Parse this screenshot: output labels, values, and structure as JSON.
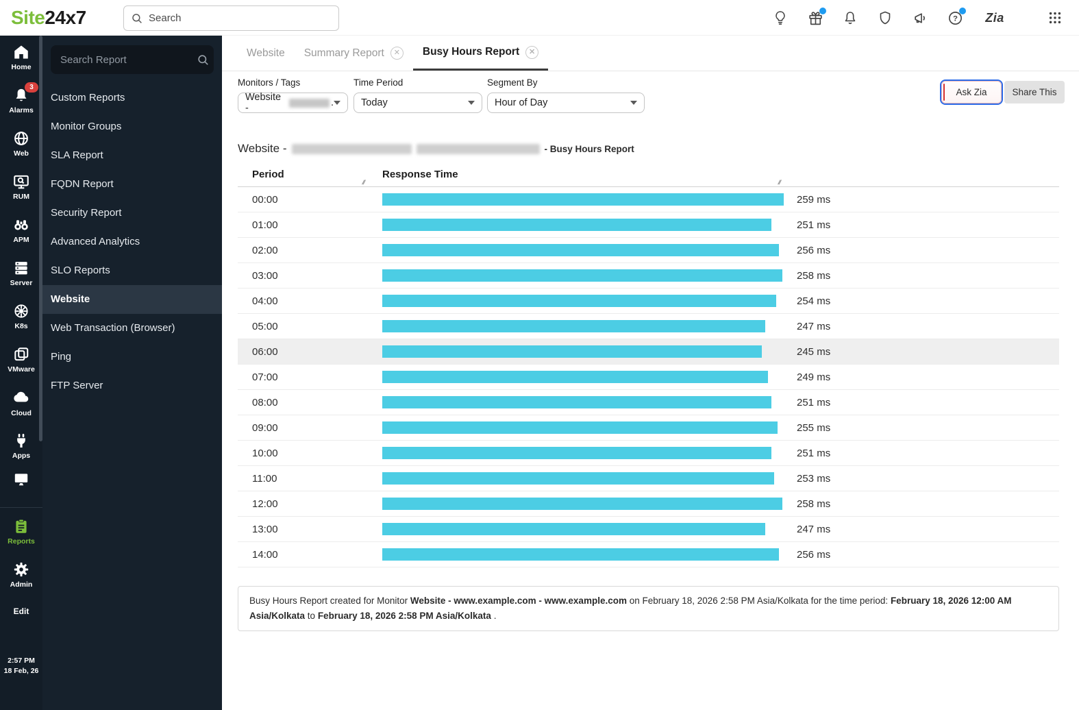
{
  "topbar": {
    "logo_part1": "Site",
    "logo_part2": "24x7",
    "search_placeholder": "Search",
    "icons": [
      {
        "name": "bulb-icon"
      },
      {
        "name": "gift-icon",
        "has_dot": true
      },
      {
        "name": "bell-icon"
      },
      {
        "name": "shield-icon"
      },
      {
        "name": "megaphone-icon"
      },
      {
        "name": "help-icon",
        "has_dot": true
      },
      {
        "name": "zia-icon",
        "label": "Zia"
      },
      {
        "name": "apps-grid-icon"
      }
    ]
  },
  "sidebar": {
    "items": [
      {
        "label": "Home"
      },
      {
        "label": "Alarms",
        "badge": "3"
      },
      {
        "label": "Web"
      },
      {
        "label": "RUM"
      },
      {
        "label": "APM"
      },
      {
        "label": "Server"
      },
      {
        "label": "K8s"
      },
      {
        "label": "VMware"
      },
      {
        "label": "Cloud"
      },
      {
        "label": "Apps"
      },
      {
        "label": ""
      },
      {
        "label": "Reports"
      },
      {
        "label": "Admin"
      },
      {
        "label": "Edit"
      }
    ],
    "time": "2:57 PM",
    "date": "18 Feb, 26"
  },
  "report_nav": {
    "search_placeholder": "Search Report",
    "items": [
      {
        "label": "Custom Reports"
      },
      {
        "label": "Monitor Groups"
      },
      {
        "label": "SLA Report"
      },
      {
        "label": "FQDN Report"
      },
      {
        "label": "Security Report"
      },
      {
        "label": "Advanced Analytics"
      },
      {
        "label": "SLO Reports"
      },
      {
        "label": "Website"
      },
      {
        "label": "Web Transaction (Browser)"
      },
      {
        "label": "Ping"
      },
      {
        "label": "FTP Server"
      }
    ],
    "active_item": "Website"
  },
  "tabs": [
    {
      "label": "Website",
      "closable": false,
      "active": false
    },
    {
      "label": "Summary Report",
      "closable": true,
      "active": false
    },
    {
      "label": "Busy Hours Report",
      "closable": true,
      "active": true
    }
  ],
  "filters": {
    "monitors_label": "Monitors / Tags",
    "monitors_value": "Website -",
    "monitors_suffix": ".",
    "time_label": "Time Period",
    "time_value": "Today",
    "segment_label": "Segment By",
    "segment_value": "Hour of Day"
  },
  "actions": {
    "ask_zia": "Ask Zia",
    "share_this": "Share This"
  },
  "report": {
    "title_prefix": "Website -",
    "title_suffix": "- Busy Hours Report"
  },
  "chart_data": {
    "type": "bar",
    "title": "Website - Busy Hours Report",
    "columns": [
      "Period",
      "Response Time"
    ],
    "categories": [
      "00:00",
      "01:00",
      "02:00",
      "03:00",
      "04:00",
      "05:00",
      "06:00",
      "07:00",
      "08:00",
      "09:00",
      "10:00",
      "11:00",
      "12:00",
      "13:00",
      "14:00"
    ],
    "values": [
      259,
      251,
      256,
      258,
      254,
      247,
      245,
      249,
      251,
      255,
      251,
      253,
      258,
      247,
      256
    ],
    "unit": "ms",
    "xlabel": "Response Time",
    "ylabel": "Period",
    "xlim": [
      0,
      259
    ],
    "bar_color": "#4ccde4",
    "highlighted_category": "06:00",
    "orientation": "horizontal",
    "legend": "none",
    "grid": "off"
  },
  "footer_note": {
    "parts": [
      {
        "text": "Busy Hours Report created for Monitor ",
        "bold": false
      },
      {
        "text": "Website - www.example.com - www.example.com",
        "bold": true
      },
      {
        "text": " on February 18, 2026 2:58 PM Asia/Kolkata for the time period: ",
        "bold": false
      },
      {
        "text": "February 18, 2026 12:00 AM Asia/Kolkata",
        "bold": true
      },
      {
        "text": " to ",
        "bold": false
      },
      {
        "text": "February 18, 2026 2:58 PM Asia/Kolkata",
        "bold": true
      },
      {
        "text": " .",
        "bold": false
      }
    ]
  },
  "colors": {
    "brand_green": "#7cbe3b",
    "bar_cyan": "#4ccde4",
    "sidebar_dark": "#131d27",
    "panel_dark": "#16212c",
    "active_item": "#2b3744",
    "alarm_red": "#d9413d",
    "notify_blue": "#1e9bf0",
    "focus_blue": "#2b6be8"
  }
}
